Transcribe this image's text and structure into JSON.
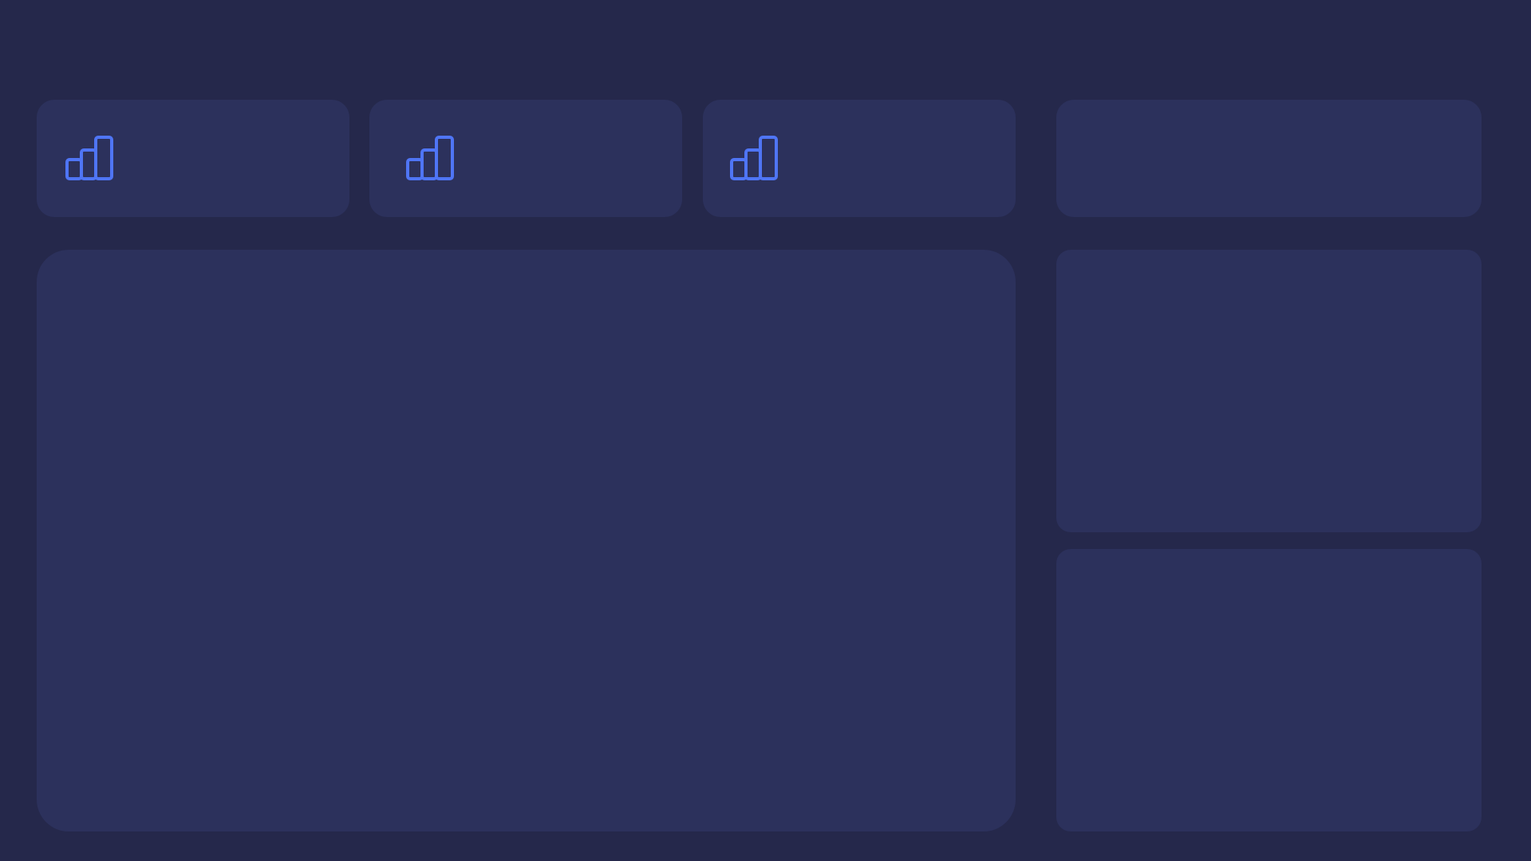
{
  "theme": {
    "background": "#25284b",
    "card": "#2c315c",
    "accent": "#4f75f5"
  },
  "stats": [
    {
      "icon": "bar-chart-icon"
    },
    {
      "icon": "bar-chart-icon"
    },
    {
      "icon": "bar-chart-icon"
    }
  ]
}
